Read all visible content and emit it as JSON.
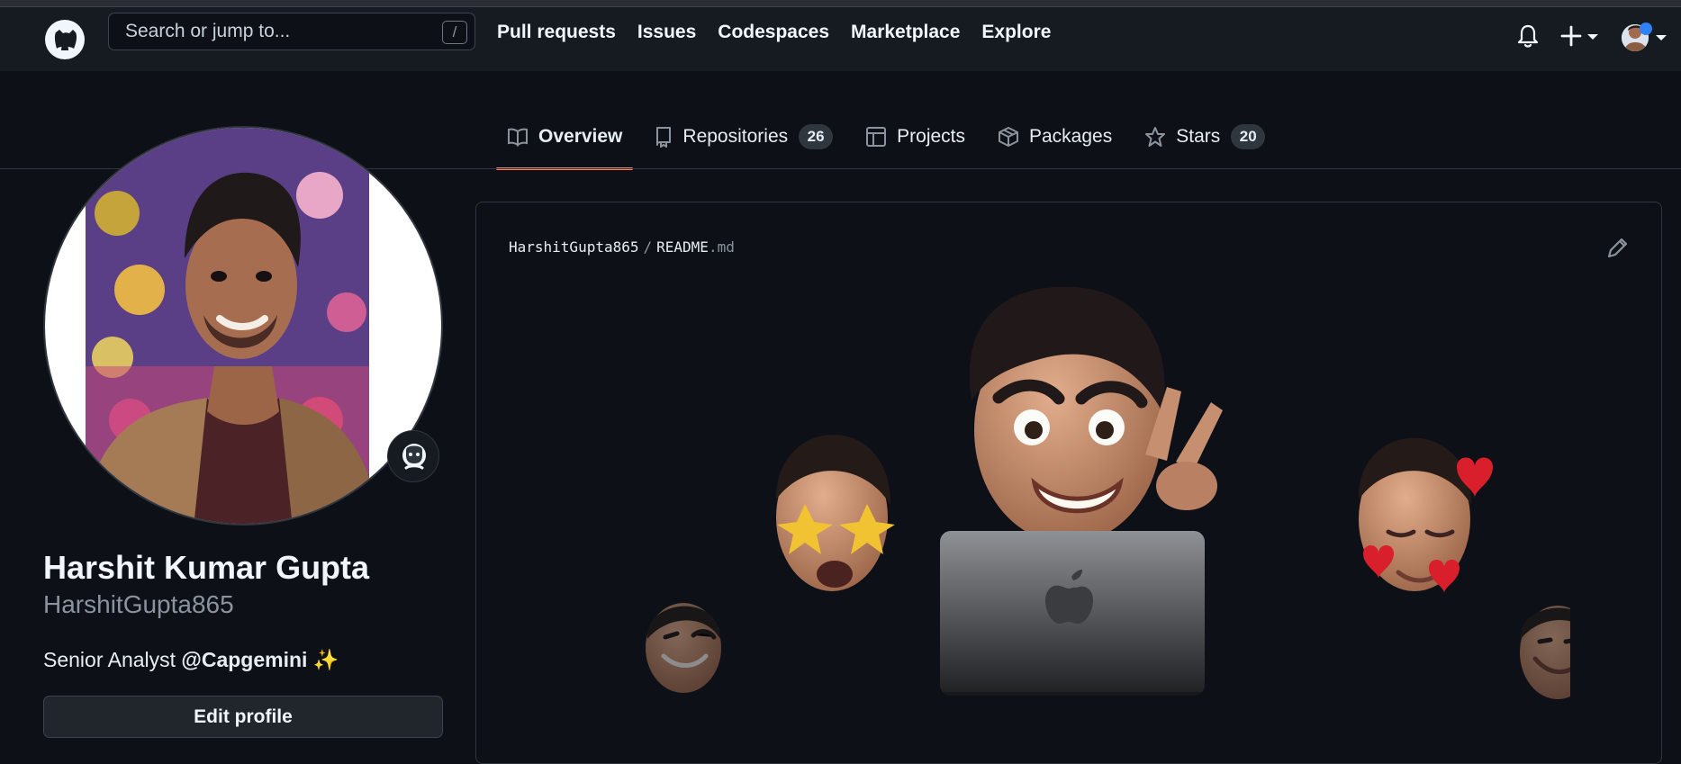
{
  "header": {
    "logo_icon": "github-mark-icon",
    "search": {
      "placeholder": "Search or jump to...",
      "shortcut": "/"
    },
    "nav": [
      "Pull requests",
      "Issues",
      "Codespaces",
      "Marketplace",
      "Explore"
    ],
    "icons": [
      "bell-icon",
      "plus-icon",
      "caret-down-icon",
      "avatar"
    ]
  },
  "tabs": [
    {
      "label": "Overview",
      "icon": "book-icon",
      "active": true
    },
    {
      "label": "Repositories",
      "icon": "repo-icon",
      "count": "26"
    },
    {
      "label": "Projects",
      "icon": "table-icon"
    },
    {
      "label": "Packages",
      "icon": "package-icon"
    },
    {
      "label": "Stars",
      "icon": "star-icon",
      "count": "20"
    }
  ],
  "profile": {
    "name": "Harshit Kumar Gupta",
    "login": "HarshitGupta865",
    "bio_prefix": "Senior Analyst",
    "bio_org": "@Capgemini",
    "bio_emoji": "✨",
    "edit_label": "Edit profile"
  },
  "readme": {
    "owner": "HarshitGupta865",
    "separator": "/",
    "filename": "README",
    "extension": ".md"
  },
  "colors": {
    "background": "#0d1117",
    "header": "#161b22",
    "accent": "#f78166",
    "border": "#30363d"
  }
}
